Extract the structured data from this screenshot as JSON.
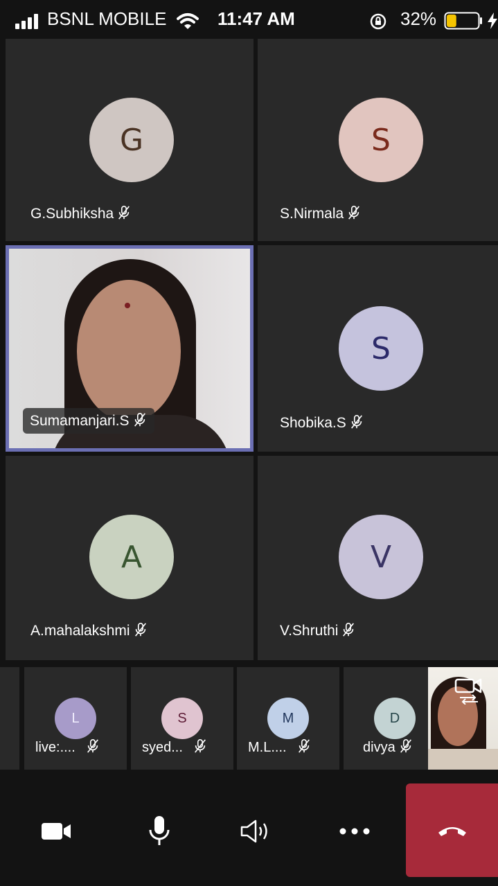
{
  "status_bar": {
    "carrier": "BSNL MOBILE",
    "time": "11:47 AM",
    "battery": "32%",
    "battery_level": 0.32
  },
  "participants": [
    {
      "initial": "G",
      "name": "G.Subhiksha",
      "avatar_bg": "#cfc6c2",
      "initial_color": "#4a3324"
    },
    {
      "initial": "S",
      "name": "S.Nirmala",
      "avatar_bg": "#e1c5bf",
      "initial_color": "#7a2a1c"
    },
    {
      "initial": "",
      "name": "Sumamanjari.S",
      "video": true
    },
    {
      "initial": "S",
      "name": "Shobika.S",
      "avatar_bg": "#c5c3dd",
      "initial_color": "#2c2a6a"
    },
    {
      "initial": "A",
      "name": "A.mahalakshmi",
      "avatar_bg": "#c9d2c0",
      "initial_color": "#385530"
    },
    {
      "initial": "V",
      "name": "V.Shruthi",
      "avatar_bg": "#c8c3d9",
      "initial_color": "#3a3465"
    }
  ],
  "strip": [
    {
      "initial": "L",
      "name": "live:....",
      "avatar_bg": "#a79bc9",
      "initial_color": "#f2efff"
    },
    {
      "initial": "S",
      "name": "syed...",
      "avatar_bg": "#e0c4d0",
      "initial_color": "#5e1d36"
    },
    {
      "initial": "M",
      "name": "M.L....",
      "avatar_bg": "#c0d0e8",
      "initial_color": "#22375c"
    },
    {
      "initial": "D",
      "name": "divya",
      "avatar_bg": "#c3d3d3",
      "initial_color": "#27464a"
    }
  ],
  "controls": {
    "camera": "camera-icon",
    "mic": "microphone-icon",
    "speaker": "speaker-icon",
    "more": "more-icon",
    "hangup": "hang-up-icon"
  }
}
